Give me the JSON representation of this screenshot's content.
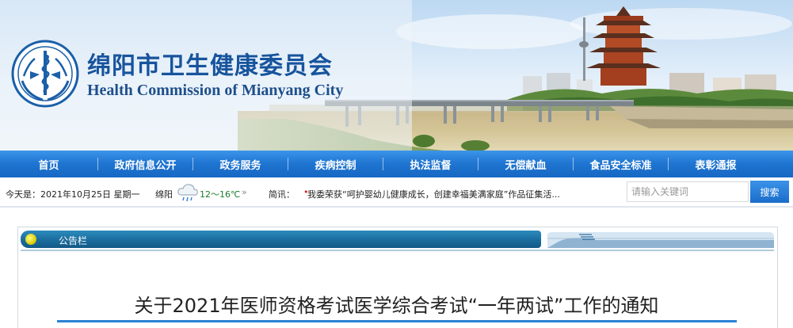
{
  "header": {
    "title_cn": "绵阳市卫生健康委员会",
    "title_en": "Health Commission of Mianyang City"
  },
  "nav": {
    "items": [
      {
        "label": "首页"
      },
      {
        "label": "政府信息公开"
      },
      {
        "label": "政务服务"
      },
      {
        "label": "疾病控制"
      },
      {
        "label": "执法监督"
      },
      {
        "label": "无偿献血"
      },
      {
        "label": "食品安全标准"
      },
      {
        "label": "表彰通报"
      }
    ]
  },
  "infobar": {
    "date": "今天是：2021年10月25日 星期一",
    "city": "绵阳",
    "temperature": "12～16℃",
    "chevron": "»",
    "news_label": "简讯：",
    "news_text": "我委荣获“呵护婴幼儿健康成长，创建幸福美满家庭”作品征集活..."
  },
  "search": {
    "placeholder": "请输入关键词",
    "button_label": "搜索"
  },
  "notice": {
    "header_label": "公告栏",
    "article_title": "关于2021年医师资格考试医学综合考试“一年两试”工作的通知"
  },
  "colors": {
    "nav_blue": "#1e74d0",
    "title_blue": "#17549d",
    "panel_tab": "#1a6c9d",
    "news_dot": "#d6201f",
    "temperature_green": "#1a7d2a"
  }
}
